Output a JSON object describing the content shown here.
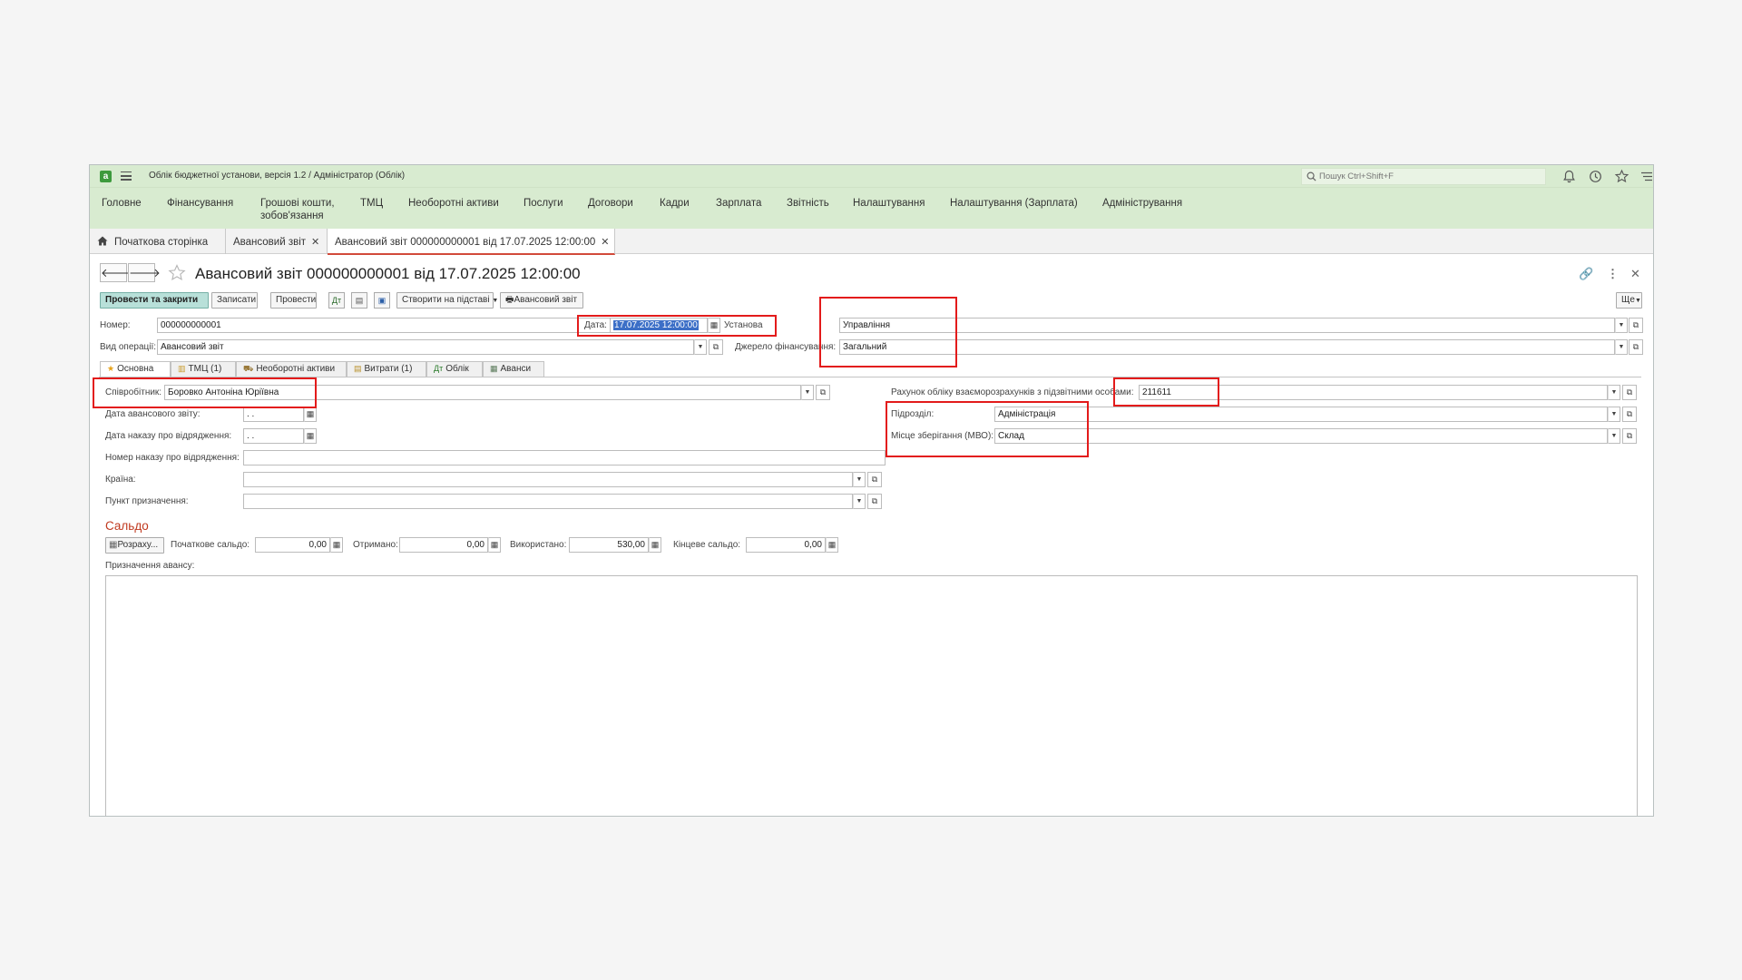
{
  "app": {
    "title": "Облік бюджетної установи, версія 1.2 / Адміністратор  (Облік)",
    "search_placeholder": "Пошук Ctrl+Shift+F",
    "logo_letter": "a"
  },
  "sections": [
    {
      "label": "Головне"
    },
    {
      "label": "Фінансування"
    },
    {
      "label": "Грошові кошти,\nзобов'язання"
    },
    {
      "label": "ТМЦ"
    },
    {
      "label": "Необоротні активи"
    },
    {
      "label": "Послуги"
    },
    {
      "label": "Договори"
    },
    {
      "label": "Кадри"
    },
    {
      "label": "Зарплата"
    },
    {
      "label": "Звітність"
    },
    {
      "label": "Налаштування"
    },
    {
      "label": "Налаштування (Зарплата)"
    },
    {
      "label": "Адміністрування"
    }
  ],
  "open_tabs": [
    {
      "label": "Початкова сторінка"
    },
    {
      "label": "Авансовий звіт"
    },
    {
      "label": "Авансовий звіт 000000000001 від 17.07.2025 12:00:00"
    }
  ],
  "form": {
    "title": "Авансовий звіт 000000000001 від 17.07.2025 12:00:00"
  },
  "toolbar": {
    "post_close": "Провести та закрити",
    "save": "Записати",
    "post": "Провести",
    "create_basis": "Створити на підставі",
    "print_report": "Авансовий звіт",
    "more": "Ще"
  },
  "header_fields": {
    "number_label": "Номер:",
    "number_value": "000000000001",
    "date_label": "Дата:",
    "date_value": "17.07.2025 12:00:00",
    "institution_label": "Установа",
    "institution_value": "Управління",
    "operation_label": "Вид операції:",
    "operation_value": "Авансовий звіт",
    "funding_label": "Джерело фінансування:",
    "funding_value": "Загальний"
  },
  "form_tabs": [
    {
      "label": "Основна",
      "icon": "star-icon"
    },
    {
      "label": "ТМЦ (1)",
      "icon": "box-icon"
    },
    {
      "label": "Необоротні активи",
      "icon": "truck-icon"
    },
    {
      "label": "Витрати (1)",
      "icon": "document-icon"
    },
    {
      "label": "Облік",
      "icon": "accounting-icon"
    },
    {
      "label": "Аванси",
      "icon": "calculator-icon"
    }
  ],
  "main": {
    "employee_label": "Співробітник:",
    "employee_value": "Боровко Антоніна Юріївна",
    "report_date_label": "Дата авансового звіту:",
    "report_date_value": " .  .",
    "order_date_label": "Дата наказу про відрядження:",
    "order_date_value": " .  .",
    "order_number_label": "Номер наказу про відрядження:",
    "order_number_value": "",
    "country_label": "Країна:",
    "country_value": "",
    "destination_label": "Пункт призначення:",
    "destination_value": "",
    "account_label": "Рахунок обліку взаєморозрахунків з підзвітними особами:",
    "account_value": "211611",
    "department_label": "Підрозділ:",
    "department_value": "Адміністрація",
    "storage_label": "Місце зберігання (МВО):",
    "storage_value": "Склад"
  },
  "saldo": {
    "heading": "Сальдо",
    "calc_button": "Розраху...",
    "opening_label": "Початкове сальдо:",
    "opening_value": "0,00",
    "received_label": "Отримано:",
    "received_value": "0,00",
    "used_label": "Використано:",
    "used_value": "530,00",
    "closing_label": "Кінцеве сальдо:",
    "closing_value": "0,00"
  },
  "purpose": {
    "label": "Призначення авансу:",
    "value": ""
  },
  "colors": {
    "accent_green": "#d8ebd0",
    "primary_button": "#b8e0d9",
    "highlight_red": "#e31b1b",
    "saldo_heading": "#c0391f"
  }
}
